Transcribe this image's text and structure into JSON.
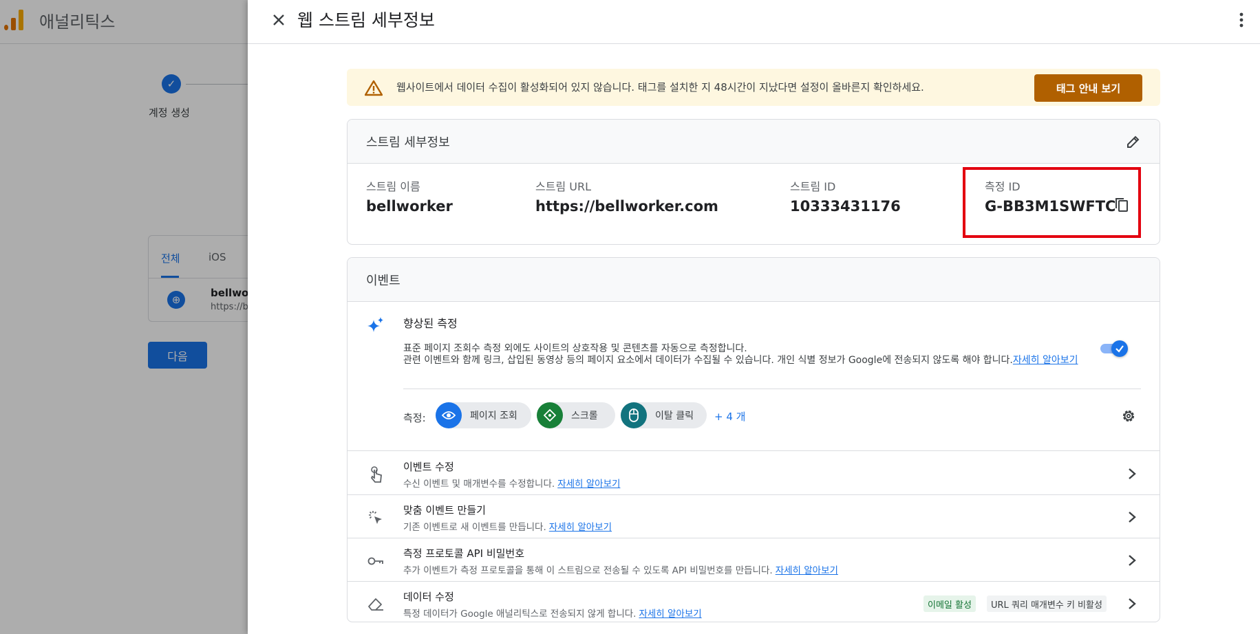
{
  "background": {
    "app_name": "애널리틱스",
    "step_label": "계정 생성",
    "tabs": [
      "전체",
      "iOS"
    ],
    "stream_item": {
      "name": "bellwor",
      "url": "https://b"
    },
    "next_button": "다음"
  },
  "panel": {
    "title": "웹 스트림 세부정보"
  },
  "alert": {
    "text": "웹사이트에서 데이터 수집이 활성화되어 있지 않습니다. 태그를 설치한 지 48시간이 지났다면 설정이 올바른지 확인하세요.",
    "button": "태그 안내 보기"
  },
  "stream_details": {
    "title": "스트림 세부정보",
    "fields": [
      {
        "label": "스트림 이름",
        "value": "bellworker"
      },
      {
        "label": "스트림 URL",
        "value": "https://bellworker.com"
      },
      {
        "label": "스트림 ID",
        "value": "10333431176"
      },
      {
        "label": "측정 ID",
        "value": "G-BB3M1SWFTC"
      }
    ]
  },
  "events": {
    "title": "이벤트",
    "enhanced": {
      "title": "향상된 측정",
      "desc_line1": "표준 페이지 조회수 측정 외에도 사이트의 상호작용 및 콘텐츠를 자동으로 측정합니다.",
      "desc_line2": "관련 이벤트와 함께 링크, 삽입된 동영상 등의 페이지 요소에서 데이터가 수집될 수 있습니다. 개인 식별 정보가 Google에 전송되지 않도록 해야 합니다.",
      "learn_more": "자세히 알아보기",
      "toggle_on": true,
      "measure_label": "측정:",
      "chips": [
        "페이지 조회",
        "스크롤",
        "이탈 클릭"
      ],
      "more": "+ 4 개"
    },
    "rows": [
      {
        "title": "이벤트 수정",
        "desc": "수신 이벤트 및 매개변수를 수정합니다.",
        "link": "자세히 알아보기"
      },
      {
        "title": "맞춤 이벤트 만들기",
        "desc": "기존 이벤트로 새 이벤트를 만듭니다.",
        "link": "자세히 알아보기"
      },
      {
        "title": "측정 프로토콜 API 비밀번호",
        "desc": "추가 이벤트가 측정 프로토콜을 통해 이 스트림으로 전송될 수 있도록 API 비밀번호를 만듭니다.",
        "link": "자세히 알아보기"
      },
      {
        "title": "데이터 수정",
        "desc": "특정 데이터가 Google 애널리틱스로 전송되지 않게 합니다.",
        "link": "자세히 알아보기",
        "badges": [
          "이메일 활성",
          "URL 쿼리 매개변수 키 비활성"
        ]
      }
    ]
  },
  "colors": {
    "accent": "#1a73e8",
    "alert_bg": "#fef7e0",
    "alert_button": "#b06000",
    "highlight_box": "#e3000f"
  }
}
